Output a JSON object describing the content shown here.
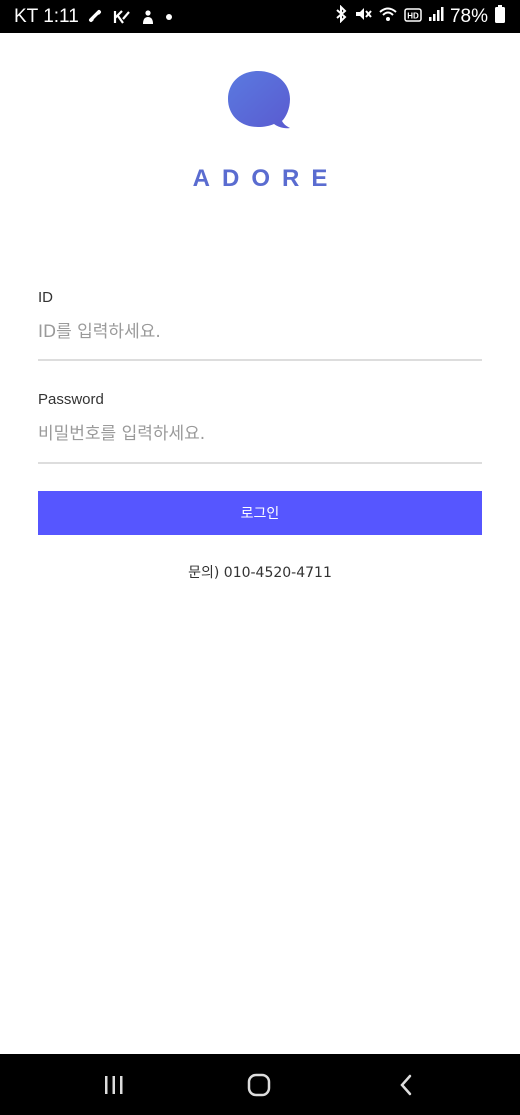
{
  "status_bar": {
    "carrier_time": "KT 1:11",
    "battery": "78%",
    "left_icons": [
      "link-icon",
      "k-icon",
      "person-icon",
      "dot-icon"
    ],
    "right_icons": [
      "bluetooth-icon",
      "mute-icon",
      "wifi-icon",
      "hd-icon",
      "signal-icon",
      "battery-icon"
    ]
  },
  "app": {
    "brand": "ADORE",
    "logo_icon": "speech-bubble-icon",
    "accent_color": "#5a6cd0",
    "id_field": {
      "label": "ID",
      "placeholder": "ID를 입력하세요.",
      "value": ""
    },
    "password_field": {
      "label": "Password",
      "placeholder": "비밀번호를 입력하세요.",
      "value": ""
    },
    "login_button": {
      "label": "로그인",
      "color": "#5656ff"
    },
    "contact": "문의) 010-4520-4711"
  },
  "nav_bar": {
    "buttons": [
      "recent-apps-icon",
      "home-icon",
      "back-icon"
    ]
  }
}
